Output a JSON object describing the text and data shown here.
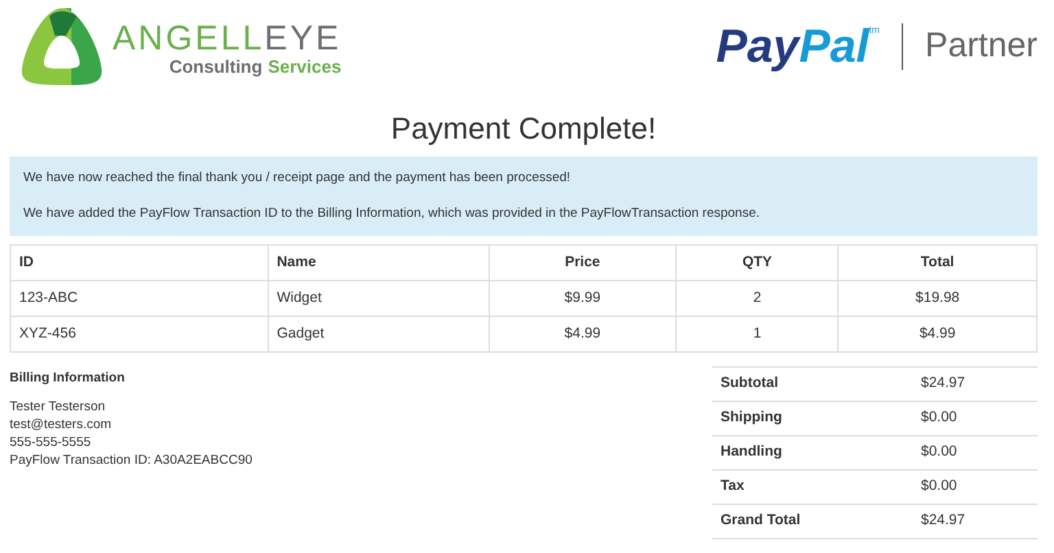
{
  "header": {
    "brand_parts": [
      {
        "text": "ANGELL",
        "color": "#6ab04c"
      },
      {
        "text": "EYE",
        "color": "#6d6e71"
      }
    ],
    "tagline_parts": [
      {
        "text": "Consulting",
        "color": "#6d6e71"
      },
      {
        "text": "Services",
        "color": "#6ab04c"
      }
    ],
    "partner": {
      "pay": "Pay",
      "pal": "Pal",
      "tm": "tm",
      "label": "Partner"
    }
  },
  "title": "Payment Complete!",
  "alert": [
    "We have now reached the final thank you / receipt page and the payment has been processed!",
    "We have added the PayFlow Transaction ID to the Billing Information, which was provided in the PayFlowTransaction response."
  ],
  "items_table": {
    "columns": [
      "ID",
      "Name",
      "Price",
      "QTY",
      "Total"
    ],
    "rows": [
      [
        "123-ABC",
        "Widget",
        "$9.99",
        "2",
        "$19.98"
      ],
      [
        "XYZ-456",
        "Gadget",
        "$4.99",
        "1",
        "$4.99"
      ]
    ]
  },
  "billing": {
    "heading": "Billing Information",
    "lines": [
      "Tester Testerson",
      "test@testers.com",
      "555-555-5555",
      "PayFlow Transaction ID: A30A2EABCC90"
    ]
  },
  "totals": [
    {
      "label": "Subtotal",
      "value": "$24.97"
    },
    {
      "label": "Shipping",
      "value": "$0.00"
    },
    {
      "label": "Handling",
      "value": "$0.00"
    },
    {
      "label": "Tax",
      "value": "$0.00"
    },
    {
      "label": "Grand Total",
      "value": "$24.97"
    }
  ]
}
